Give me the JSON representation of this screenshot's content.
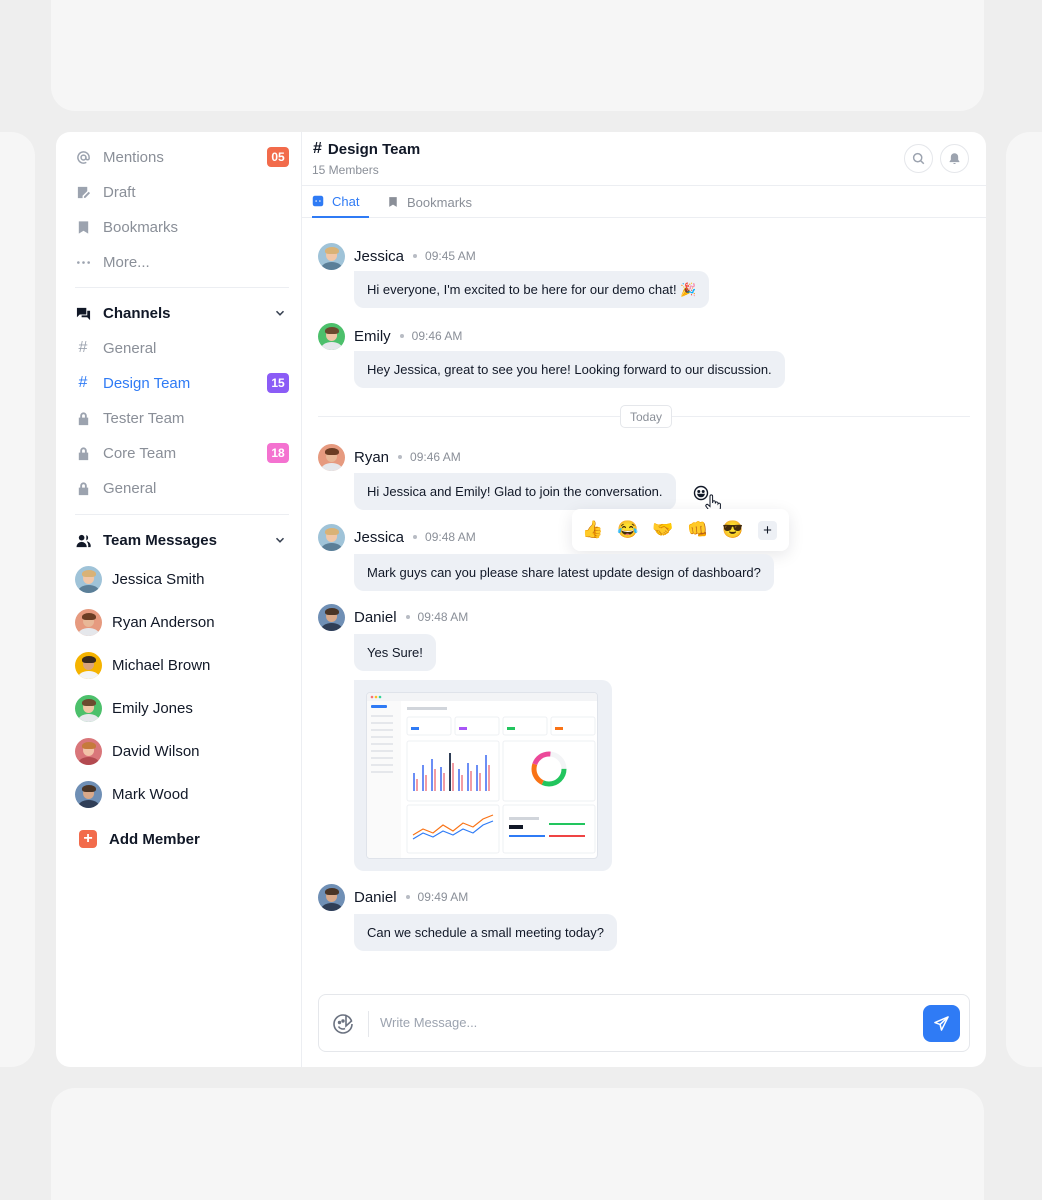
{
  "sidebar": {
    "quick": [
      {
        "label": "Mentions",
        "icon": "at-icon",
        "badge": "05",
        "badge_color": "#f26b4b"
      },
      {
        "label": "Draft",
        "icon": "draft-icon"
      },
      {
        "label": "Bookmarks",
        "icon": "bookmark-icon"
      },
      {
        "label": "More...",
        "icon": "more-icon"
      }
    ],
    "channels_title": "Channels",
    "channels": [
      {
        "label": "General",
        "icon": "hash-icon"
      },
      {
        "label": "Design Team",
        "icon": "hash-icon",
        "badge": "15",
        "badge_color": "#8b5cf6",
        "active": true
      },
      {
        "label": "Tester Team",
        "icon": "lock-icon"
      },
      {
        "label": "Core Team",
        "icon": "lock-icon",
        "badge": "18",
        "badge_color": "#f472d0"
      },
      {
        "label": "General",
        "icon": "lock-icon"
      }
    ],
    "team_title": "Team Messages",
    "team": [
      {
        "label": "Jessica Smith"
      },
      {
        "label": "Ryan Anderson"
      },
      {
        "label": "Michael Brown"
      },
      {
        "label": "Emily Jones"
      },
      {
        "label": "David Wilson"
      },
      {
        "label": "Mark Wood"
      }
    ],
    "add_member": "Add Member"
  },
  "header": {
    "title": "Design Team",
    "members": "15 Members"
  },
  "tabs": {
    "chat": "Chat",
    "bookmarks": "Bookmarks"
  },
  "messages": [
    {
      "name": "Jessica",
      "time": "09:45 AM",
      "text": "Hi everyone, I'm excited to be here for our demo chat! 🎉"
    },
    {
      "name": "Emily",
      "time": "09:46 AM",
      "text": "Hey Jessica, great to see you here! Looking forward to our discussion."
    },
    {
      "name": "Ryan",
      "time": "09:46 AM",
      "text": "Hi Jessica and Emily! Glad to join the conversation."
    },
    {
      "name": "Jessica",
      "time": "09:48 AM",
      "text": "Mark guys  can you please share latest update design of dashboard?"
    },
    {
      "name": "Daniel",
      "time": "09:48 AM",
      "text": "Yes Sure!"
    },
    {
      "name": "Daniel",
      "time": "09:49 AM",
      "text": "Can we schedule a small meeting today?"
    }
  ],
  "divider": "Today",
  "reactions": [
    "👍",
    "😂",
    "🤝",
    "👊",
    "😎",
    "+"
  ],
  "composer": {
    "placeholder": "Write Message..."
  },
  "colors": {
    "accent": "#2f7bf5",
    "mentions_badge": "#f26b4b",
    "design_badge": "#8b5cf6",
    "core_badge": "#f472d0"
  }
}
